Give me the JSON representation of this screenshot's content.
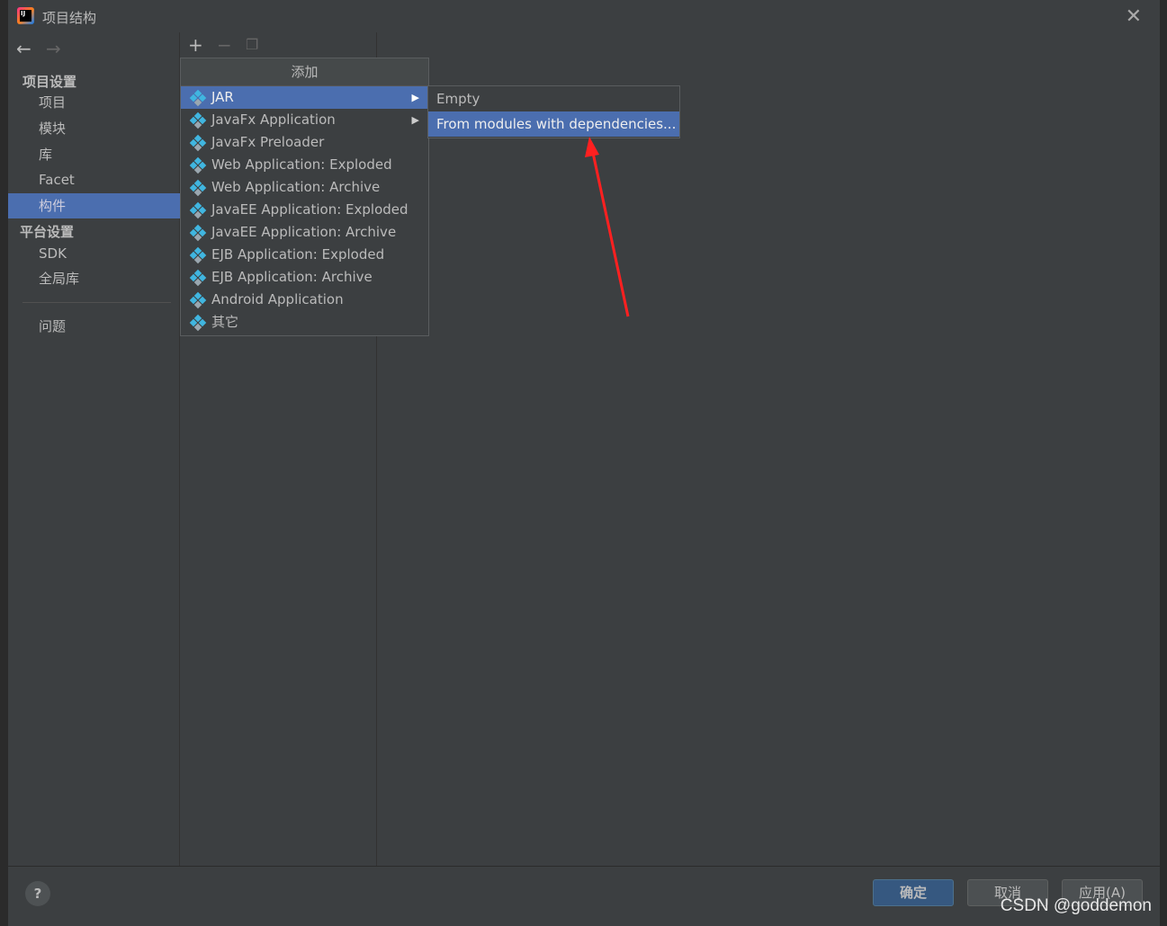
{
  "window": {
    "title": "项目结构"
  },
  "sidebar": {
    "sections": [
      {
        "label": "项目设置",
        "items": [
          "项目",
          "模块",
          "库",
          "Facet",
          "构件"
        ]
      },
      {
        "label": "平台设置",
        "items": [
          "SDK",
          "全局库"
        ]
      }
    ],
    "problems": "问题",
    "selected": "构件"
  },
  "menu": {
    "title": "添加",
    "items": [
      {
        "label": "JAR",
        "icon": "artifact-icon",
        "submenu": true
      },
      {
        "label": "JavaFx Application",
        "icon": "artifact-icon",
        "submenu": true
      },
      {
        "label": "JavaFx Preloader",
        "icon": "artifact-icon"
      },
      {
        "label": "Web Application: Exploded",
        "icon": "web-artifact-icon"
      },
      {
        "label": "Web Application: Archive",
        "icon": "web-artifact-icon"
      },
      {
        "label": "JavaEE Application: Exploded",
        "icon": "javaee-artifact-icon"
      },
      {
        "label": "JavaEE Application: Archive",
        "icon": "javaee-artifact-icon"
      },
      {
        "label": "EJB Application: Exploded",
        "icon": "ejb-artifact-icon"
      },
      {
        "label": "EJB Application: Archive",
        "icon": "ejb-artifact-icon"
      },
      {
        "label": "Android Application",
        "icon": "artifact-icon"
      },
      {
        "label": "其它",
        "icon": "artifact-icon"
      }
    ],
    "submenu": [
      "Empty",
      "From modules with dependencies..."
    ]
  },
  "footer": {
    "help": "?",
    "ok": "确定",
    "cancel": "取消",
    "apply": "应用(A)"
  },
  "watermark": "CSDN @goddemon",
  "colors": {
    "selection": "#4b6eaf",
    "annotation_arrow": "#ff2020",
    "primary_button": "#365880"
  }
}
